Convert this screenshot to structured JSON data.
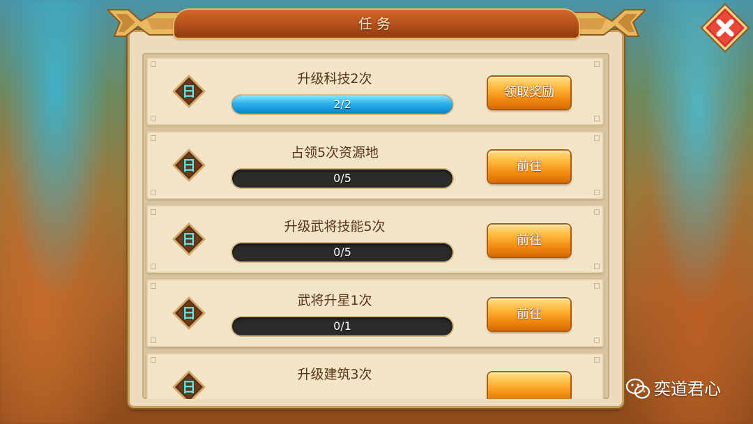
{
  "window": {
    "title": "任务"
  },
  "close_button": {
    "icon": "close-x-icon",
    "color": "#d9342a"
  },
  "tasks": [
    {
      "badge": "日",
      "name": "升级科技2次",
      "progress_text": "2/2",
      "progress_fraction": 1.0,
      "action_label": "领取奖励"
    },
    {
      "badge": "日",
      "name": "占领5次资源地",
      "progress_text": "0/5",
      "progress_fraction": 0.0,
      "action_label": "前往"
    },
    {
      "badge": "日",
      "name": "升级武将技能5次",
      "progress_text": "0/5",
      "progress_fraction": 0.0,
      "action_label": "前往"
    },
    {
      "badge": "日",
      "name": "武将升星1次",
      "progress_text": "0/1",
      "progress_fraction": 0.0,
      "action_label": "前往"
    },
    {
      "badge": "日",
      "name": "升级建筑3次",
      "progress_text": "",
      "progress_fraction": 0.0,
      "action_label": ""
    }
  ],
  "colors": {
    "progress_fill": "#29b2ee",
    "button_orange": "#f08a10",
    "title_bar": "#b24f1a"
  },
  "watermark": {
    "icon": "wechat-icon",
    "text": "奕道君心"
  }
}
